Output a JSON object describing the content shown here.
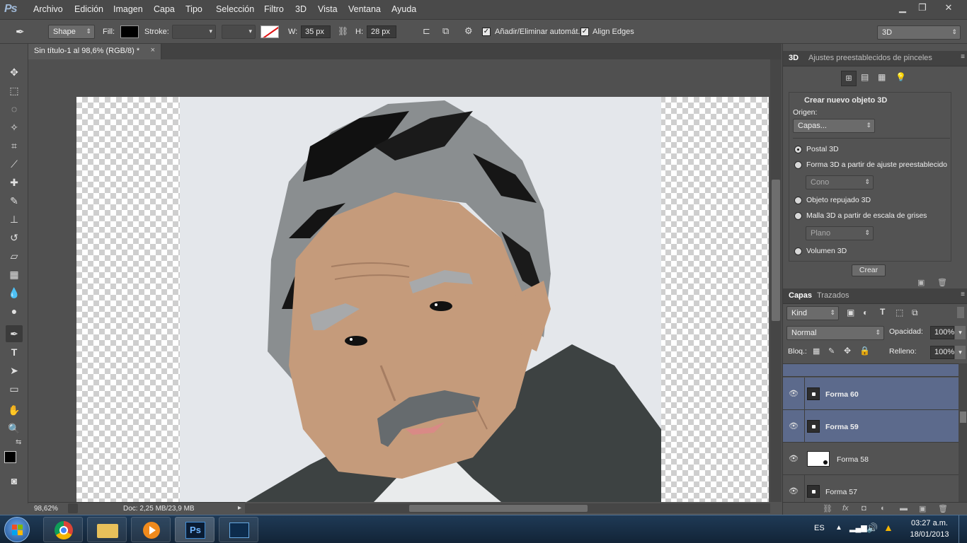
{
  "app": {
    "logo": "Ps"
  },
  "menu": [
    "Archivo",
    "Edición",
    "Imagen",
    "Capa",
    "Tipo",
    "Selección",
    "Filtro",
    "3D",
    "Vista",
    "Ventana",
    "Ayuda"
  ],
  "window_controls": {
    "minimize": "▁",
    "restore": "❐",
    "close": "✕"
  },
  "options": {
    "mode": "Shape",
    "fill_label": "Fill:",
    "stroke_label": "Stroke:",
    "width_label": "W:",
    "width_value": "35 px",
    "height_label": "H:",
    "height_value": "28 px",
    "auto_add_delete": "Añadir/Eliminar automát.",
    "align_edges": "Align Edges",
    "workspace": "3D",
    "fill_color": "#000000"
  },
  "document": {
    "tab_title": "Sin título-1 al 98,6% (RGB/8) *",
    "close": "×"
  },
  "status": {
    "zoom": "98,62%",
    "doc_info": "Doc: 2,25 MB/23,9 MB"
  },
  "panel3d": {
    "tabs": [
      "3D",
      "Ajustes preestablecidos de pinceles"
    ],
    "section_title": "Crear nuevo objeto 3D",
    "origin_label": "Origen:",
    "origin_value": "Capas...",
    "options": [
      {
        "label": "Postal 3D",
        "selected": true
      },
      {
        "label": "Forma 3D a partir de ajuste preestablecido",
        "selected": false
      },
      {
        "label": "Objeto repujado 3D",
        "selected": false
      },
      {
        "label": "Malla 3D a partir de escala de grises",
        "selected": false
      },
      {
        "label": "Volumen 3D",
        "selected": false
      }
    ],
    "shape_preset": "Cono",
    "mesh_preset": "Plano",
    "create_button": "Crear"
  },
  "layers_panel": {
    "tabs": [
      "Capas",
      "Trazados"
    ],
    "kind": "Kind",
    "blend_mode": "Normal",
    "opacity_label": "Opacidad:",
    "opacity_value": "100%",
    "lock_label": "Bloq.:",
    "fill_label": "Relleno:",
    "fill_value": "100%",
    "layers": [
      {
        "name": "Forma 60",
        "selected": true
      },
      {
        "name": "Forma 59",
        "selected": true
      },
      {
        "name": "Forma 58",
        "selected": false
      },
      {
        "name": "Forma 57",
        "selected": false
      }
    ]
  },
  "taskbar": {
    "language": "ES",
    "time": "03:27 a.m.",
    "date": "18/01/2013",
    "ps_label": "Ps"
  }
}
